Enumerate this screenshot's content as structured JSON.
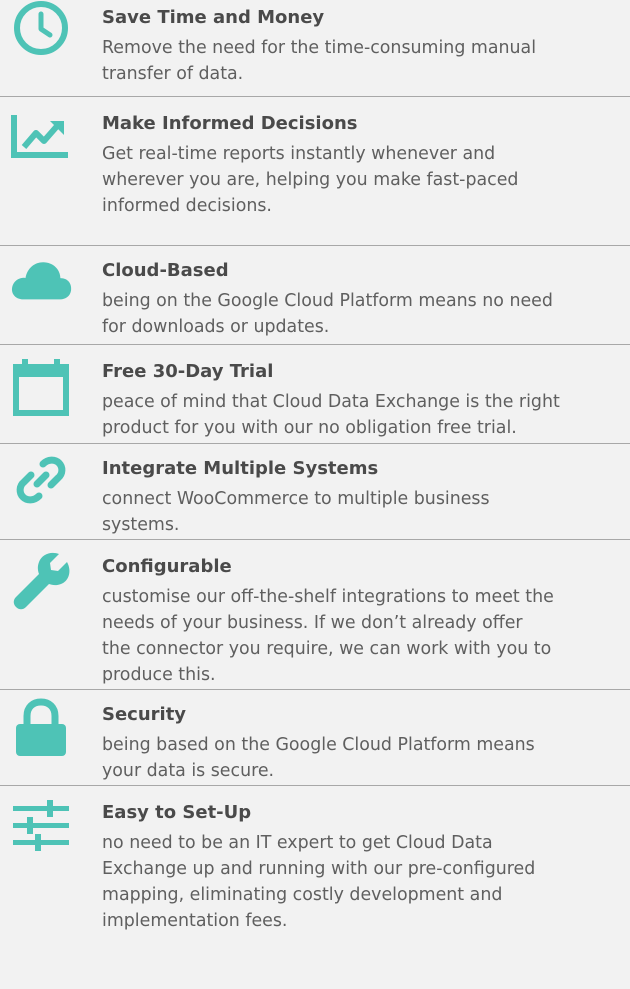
{
  "theme": {
    "accent": "#4ec3b6",
    "divider": "#a8a8a8",
    "background": "#f2f2f2"
  },
  "features": [
    {
      "icon": "clock-icon",
      "title": "Save Time and Money",
      "description": "Remove the need for the time-consuming manual\ntransfer of data."
    },
    {
      "icon": "chart-icon",
      "title": "Make Informed Decisions",
      "description": "Get real-time reports instantly whenever and\nwherever you are, helping you make fast-paced\ninformed decisions."
    },
    {
      "icon": "cloud-icon",
      "title": "Cloud-Based",
      "description": "being on the Google Cloud Platform means no need\nfor downloads or updates."
    },
    {
      "icon": "calendar-icon",
      "title": "Free 30-Day Trial",
      "description": "peace of mind that Cloud Data Exchange is the right\nproduct for you with our no obligation free trial."
    },
    {
      "icon": "link-icon",
      "title": "Integrate Multiple Systems",
      "description": "connect WooCommerce to multiple business\nsystems."
    },
    {
      "icon": "wrench-icon",
      "title": "Configurable",
      "description": "customise our off-the-shelf integrations to meet the\nneeds of your business.  If we don’t already offer\nthe connector you require, we can work with you to\nproduce this."
    },
    {
      "icon": "lock-icon",
      "title": "Security",
      "description": "being based on the Google Cloud Platform means\nyour data is secure."
    },
    {
      "icon": "sliders-icon",
      "title": "Easy to Set-Up",
      "description": "no need to be an IT expert to get Cloud Data\nExchange up and running with our pre-configured\nmapping, eliminating costly development and\nimplementation fees."
    }
  ]
}
